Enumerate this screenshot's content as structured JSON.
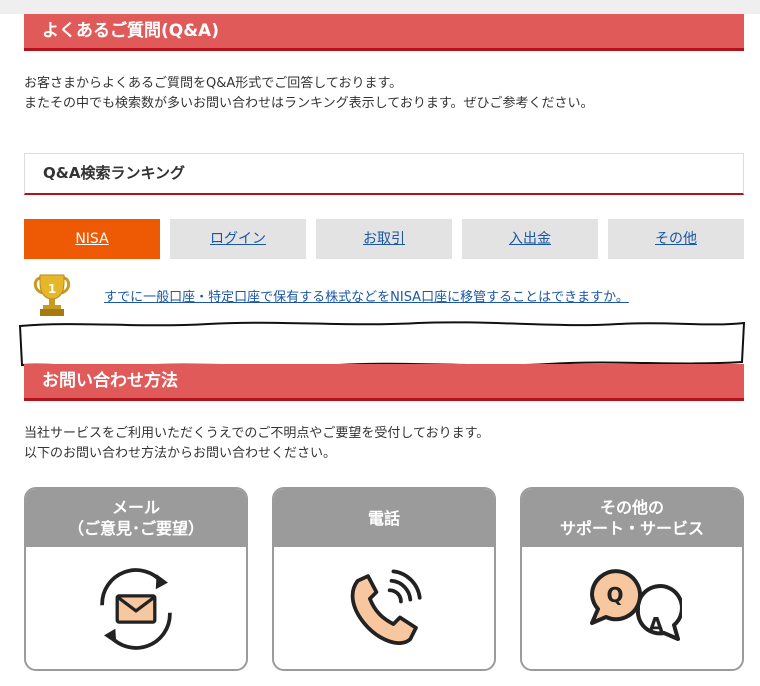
{
  "qa": {
    "title": "よくあるご質問(Q&A)",
    "intro_line1": "お客さまからよくあるご質問をQ&A形式でご回答しております。",
    "intro_line2": "またその中でも検索数が多いお問い合わせはランキング表示しております。ぜひご参考ください。"
  },
  "ranking": {
    "title": "Q&A検索ランキング",
    "tabs": [
      {
        "label": "NISA",
        "active": true
      },
      {
        "label": "ログイン",
        "active": false
      },
      {
        "label": "お取引",
        "active": false
      },
      {
        "label": "入出金",
        "active": false
      },
      {
        "label": "その他",
        "active": false
      }
    ],
    "rank_number": "1",
    "top_question": "すでに一般口座・特定口座で保有する株式などをNISA口座に移管することはできますか。"
  },
  "contact": {
    "title": "お問い合わせ方法",
    "intro_line1": "当社サービスをご利用いただくうえでのご不明点やご要望を受付しております。",
    "intro_line2": "以下のお問い合わせ方法からお問い合わせください。",
    "cards": [
      {
        "line1": "メール",
        "line2": "（ご意見･ご要望）",
        "icon": "mail-icon"
      },
      {
        "line1": "電話",
        "line2": "",
        "icon": "phone-icon"
      },
      {
        "line1": "その他の",
        "line2": "サポート・サービス",
        "icon": "qa-bubbles-icon"
      }
    ],
    "qa_icon_q": "Q",
    "qa_icon_a": "A"
  },
  "colors": {
    "header_bg": "#e05a5a",
    "header_border": "#b5111a",
    "tab_active": "#ee5a04",
    "tab_inactive": "#e3e3e3",
    "link": "#1b57a5",
    "card_gray": "#9b9b9b",
    "icon_fill": "#f7c7a0"
  }
}
